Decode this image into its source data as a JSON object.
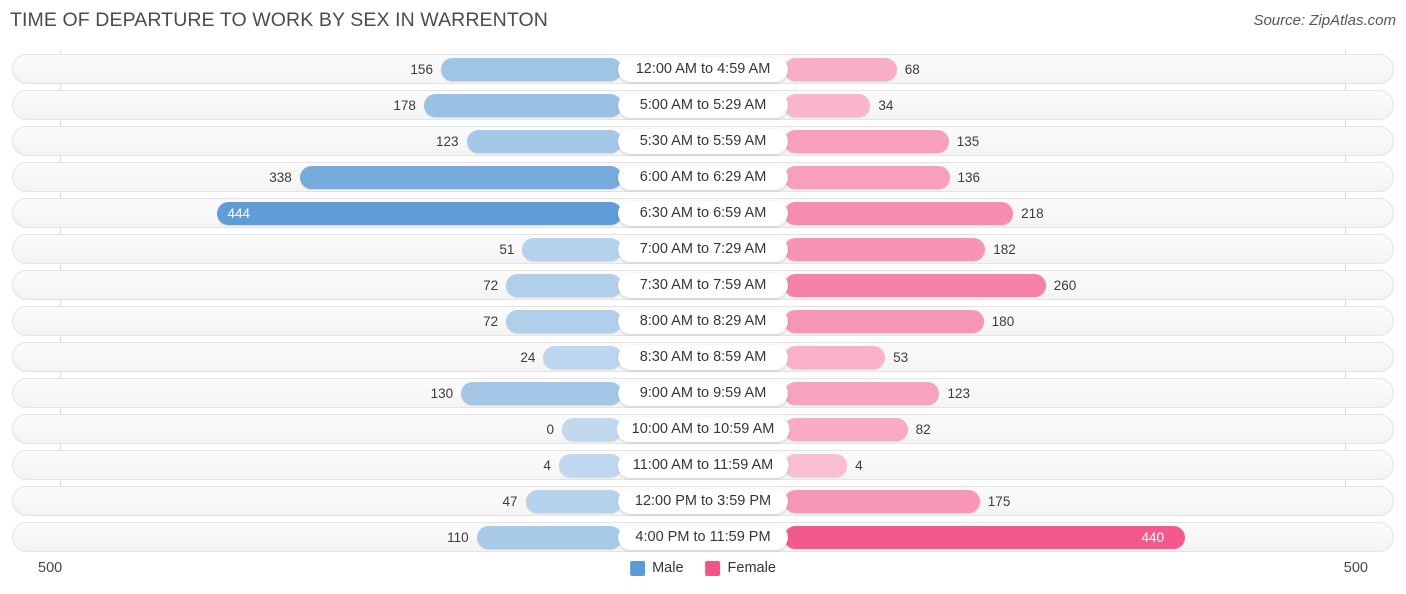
{
  "header": {
    "title": "TIME OF DEPARTURE TO WORK BY SEX IN WARRENTON",
    "source": "Source: ZipAtlas.com"
  },
  "legend": {
    "items": [
      {
        "label": "Male",
        "color": "#5b9bd5"
      },
      {
        "label": "Female",
        "color": "#f2548a"
      }
    ]
  },
  "axis": {
    "left_tick": "500",
    "right_tick": "500"
  },
  "chart_data": {
    "type": "bar",
    "orientation": "horizontal-diverging",
    "title": "TIME OF DEPARTURE TO WORK BY SEX IN WARRENTON",
    "xlabel": "",
    "ylabel": "",
    "xlim": [
      500,
      500
    ],
    "grid": false,
    "legend_position": "bottom-center",
    "categories": [
      "12:00 AM to 4:59 AM",
      "5:00 AM to 5:29 AM",
      "5:30 AM to 5:59 AM",
      "6:00 AM to 6:29 AM",
      "6:30 AM to 6:59 AM",
      "7:00 AM to 7:29 AM",
      "7:30 AM to 7:59 AM",
      "8:00 AM to 8:29 AM",
      "8:30 AM to 8:59 AM",
      "9:00 AM to 9:59 AM",
      "10:00 AM to 10:59 AM",
      "11:00 AM to 11:59 AM",
      "12:00 PM to 3:59 PM",
      "4:00 PM to 11:59 PM"
    ],
    "series": [
      {
        "name": "Male",
        "color": "#5b9bd5",
        "values": [
          156,
          178,
          123,
          338,
          444,
          51,
          72,
          72,
          24,
          130,
          0,
          4,
          47,
          110
        ]
      },
      {
        "name": "Female",
        "color": "#f2548a",
        "values": [
          68,
          34,
          135,
          136,
          218,
          182,
          260,
          180,
          53,
          123,
          82,
          4,
          175,
          440
        ]
      }
    ]
  }
}
